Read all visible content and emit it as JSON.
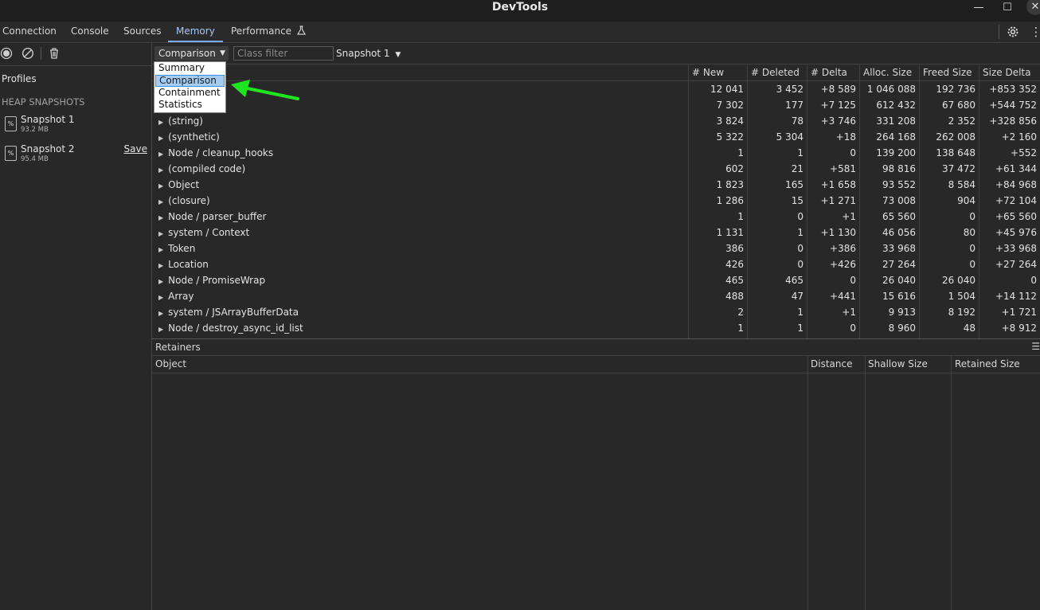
{
  "window": {
    "title": "DevTools"
  },
  "tabs": [
    {
      "label": "Connection"
    },
    {
      "label": "Console"
    },
    {
      "label": "Sources"
    },
    {
      "label": "Memory"
    },
    {
      "label": "Performance"
    }
  ],
  "sidebar": {
    "profiles_label": "Profiles",
    "section_label": "HEAP SNAPSHOTS",
    "snapshots": [
      {
        "name": "Snapshot 1",
        "size": "93.2 MB"
      },
      {
        "name": "Snapshot 2",
        "size": "95.4 MB",
        "action": "Save"
      }
    ]
  },
  "toolbar": {
    "view_selected": "Comparison",
    "class_filter_placeholder": "Class filter",
    "base_snapshot": "Snapshot 1"
  },
  "dropdown": {
    "options": [
      "Summary",
      "Comparison",
      "Containment",
      "Statistics"
    ],
    "selected": "Comparison"
  },
  "grid": {
    "columns": [
      "# New",
      "# Deleted",
      "# Delta",
      "Alloc. Size",
      "Freed Size",
      "Size Delta"
    ],
    "rows": [
      {
        "name": "",
        "new": "12 041",
        "deleted": "3 452",
        "delta": "+8 589",
        "alloc": "1 046 088",
        "freed": "192 736",
        "size_delta": "+853 352"
      },
      {
        "name": "",
        "new": "7 302",
        "deleted": "177",
        "delta": "+7 125",
        "alloc": "612 432",
        "freed": "67 680",
        "size_delta": "+544 752"
      },
      {
        "name": "(string)",
        "new": "3 824",
        "deleted": "78",
        "delta": "+3 746",
        "alloc": "331 208",
        "freed": "2 352",
        "size_delta": "+328 856"
      },
      {
        "name": "(synthetic)",
        "new": "5 322",
        "deleted": "5 304",
        "delta": "+18",
        "alloc": "264 168",
        "freed": "262 008",
        "size_delta": "+2 160"
      },
      {
        "name": "Node / cleanup_hooks",
        "new": "1",
        "deleted": "1",
        "delta": "0",
        "alloc": "139 200",
        "freed": "138 648",
        "size_delta": "+552"
      },
      {
        "name": "(compiled code)",
        "new": "602",
        "deleted": "21",
        "delta": "+581",
        "alloc": "98 816",
        "freed": "37 472",
        "size_delta": "+61 344"
      },
      {
        "name": "Object",
        "new": "1 823",
        "deleted": "165",
        "delta": "+1 658",
        "alloc": "93 552",
        "freed": "8 584",
        "size_delta": "+84 968"
      },
      {
        "name": "(closure)",
        "new": "1 286",
        "deleted": "15",
        "delta": "+1 271",
        "alloc": "73 008",
        "freed": "904",
        "size_delta": "+72 104"
      },
      {
        "name": "Node / parser_buffer",
        "new": "1",
        "deleted": "0",
        "delta": "+1",
        "alloc": "65 560",
        "freed": "0",
        "size_delta": "+65 560"
      },
      {
        "name": "system / Context",
        "new": "1 131",
        "deleted": "1",
        "delta": "+1 130",
        "alloc": "46 056",
        "freed": "80",
        "size_delta": "+45 976"
      },
      {
        "name": "Token",
        "new": "386",
        "deleted": "0",
        "delta": "+386",
        "alloc": "33 968",
        "freed": "0",
        "size_delta": "+33 968"
      },
      {
        "name": "Location",
        "new": "426",
        "deleted": "0",
        "delta": "+426",
        "alloc": "27 264",
        "freed": "0",
        "size_delta": "+27 264"
      },
      {
        "name": "Node / PromiseWrap",
        "new": "465",
        "deleted": "465",
        "delta": "0",
        "alloc": "26 040",
        "freed": "26 040",
        "size_delta": "0"
      },
      {
        "name": "Array",
        "new": "488",
        "deleted": "47",
        "delta": "+441",
        "alloc": "15 616",
        "freed": "1 504",
        "size_delta": "+14 112"
      },
      {
        "name": "system / JSArrayBufferData",
        "new": "2",
        "deleted": "1",
        "delta": "+1",
        "alloc": "9 913",
        "freed": "8 192",
        "size_delta": "+1 721"
      },
      {
        "name": "Node / destroy_async_id_list",
        "new": "1",
        "deleted": "1",
        "delta": "0",
        "alloc": "8 960",
        "freed": "48",
        "size_delta": "+8 912"
      }
    ]
  },
  "retainers": {
    "title": "Retainers",
    "columns": [
      "Object",
      "Distance",
      "Shallow Size",
      "Retained Size"
    ]
  },
  "colors": {
    "accent": "#7cacf8",
    "arrow": "#1ee61e",
    "background": "#282828"
  },
  "icons": [
    "record-icon",
    "clear-icon",
    "trash-icon",
    "settings-gear-icon",
    "more-vert-icon",
    "flask-icon",
    "heap-file-icon"
  ]
}
